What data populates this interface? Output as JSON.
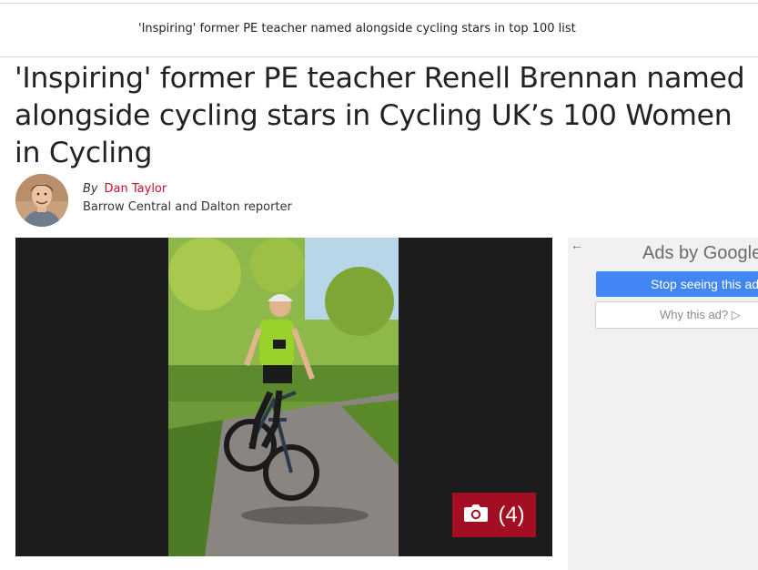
{
  "sticky": {
    "title": "'Inspiring' former PE teacher named alongside cycling stars in top 100 list"
  },
  "article": {
    "headline": "'Inspiring' former PE teacher Renell Brennan named alongside cycling stars in Cycling UK’s 100 Women in Cycling",
    "byline": {
      "by": "By",
      "author": "Dan Taylor",
      "role": "Barrow Central and Dalton reporter"
    },
    "gallery": {
      "count": "(4)",
      "icon": "camera-icon"
    }
  },
  "ad": {
    "back_icon": "←",
    "ads_by": "Ads by",
    "brand": "Google",
    "stop_label": "Stop seeing this ad",
    "why_label": "Why this ad? ▷"
  },
  "colors": {
    "accent_red": "#c8102e",
    "badge_red": "#a40e22",
    "ad_blue": "#4285f4"
  }
}
